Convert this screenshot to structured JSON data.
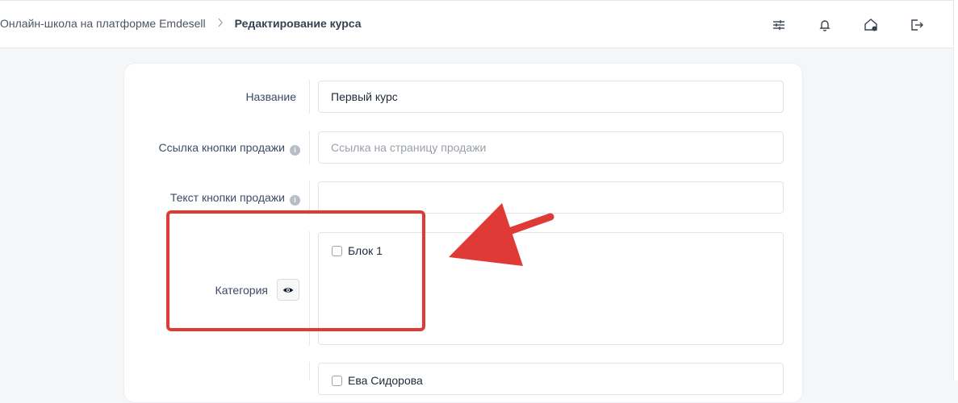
{
  "header": {
    "breadcrumb_link": "Онлайн-школа на платформе Emdesell",
    "breadcrumb_separator": ">",
    "breadcrumb_current": "Редактирование курса",
    "icons": [
      "sliders-icon",
      "bell-icon",
      "home-settings-icon",
      "logout-icon"
    ]
  },
  "form": {
    "name_label": "Название",
    "name_value": "Первый курс",
    "sale_link_label": "Ссылка кнопки продажи",
    "sale_link_placeholder": "Ссылка на страницу продажи",
    "sale_text_label": "Текст кнопки продажи",
    "sale_text_value": "",
    "info_glyph": "i",
    "category_label": "Категория",
    "category_options": [
      "Блок 1"
    ],
    "next_option_partial": "Ева Сидорова"
  },
  "annotation": {
    "highlight_color": "#e03a36",
    "arrow_color": "#e03a36"
  }
}
